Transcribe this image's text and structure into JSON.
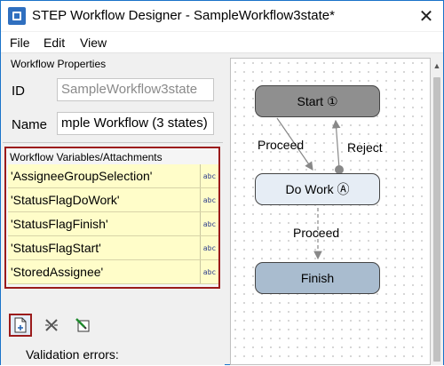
{
  "window": {
    "title": "STEP Workflow Designer - SampleWorkflow3state*",
    "close_glyph": "✕"
  },
  "menu": [
    {
      "label": "File"
    },
    {
      "label": "Edit"
    },
    {
      "label": "View"
    }
  ],
  "workflow_properties": {
    "section_label": "Workflow Properties",
    "id_label": "ID",
    "id_value": "SampleWorkflow3state",
    "name_label": "Name",
    "name_value": "mple Workflow (3 states)"
  },
  "variables": {
    "section_label": "Workflow Variables/Attachments",
    "items": [
      {
        "name": "'AssigneeGroupSelection'",
        "type_icon": "abc"
      },
      {
        "name": "'StatusFlagDoWork'",
        "type_icon": "abc"
      },
      {
        "name": "'StatusFlagFinish'",
        "type_icon": "abc"
      },
      {
        "name": "'StatusFlagStart'",
        "type_icon": "abc"
      },
      {
        "name": "'StoredAssignee'",
        "type_icon": "abc"
      }
    ]
  },
  "toolbar": {
    "buttons": [
      {
        "icon": "add-variable-icon",
        "selected": true
      },
      {
        "icon": "delete-variable-icon",
        "selected": false
      },
      {
        "icon": "edit-variable-icon",
        "selected": false
      }
    ]
  },
  "validation": {
    "label": "Validation errors:"
  },
  "diagram": {
    "states": [
      {
        "label": "Start ①",
        "fill": "#8f8f8f"
      },
      {
        "label": "Do Work Ⓐ",
        "fill": "#e6edf5"
      },
      {
        "label": "Finish",
        "fill": "#a9bccf"
      }
    ],
    "transitions": [
      {
        "label": "Proceed"
      },
      {
        "label": "Reject"
      },
      {
        "label": "Proceed"
      }
    ]
  },
  "colors": {
    "highlight_border": "#9b1b1b",
    "variable_row_bg": "#fffdc9",
    "window_border": "#1a73c9"
  }
}
